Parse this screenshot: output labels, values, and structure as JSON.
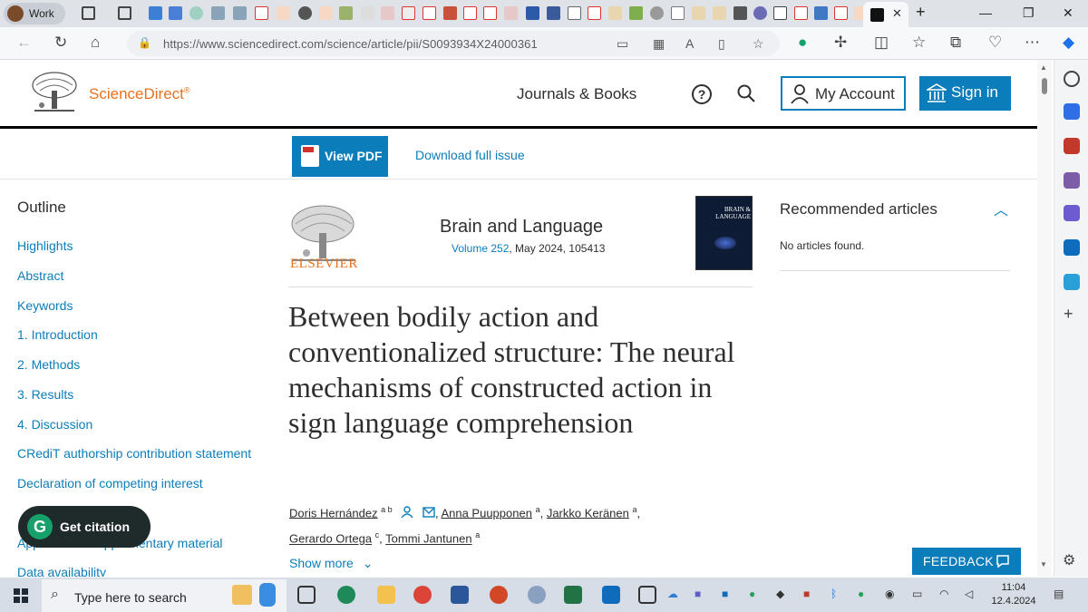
{
  "browser": {
    "profile_label": "Work",
    "url": "https://www.sciencedirect.com/science/article/pii/S0093934X24000361"
  },
  "header": {
    "brand": "ScienceDirect",
    "brand_mark": "®",
    "journals_books": "Journals & Books",
    "my_account": "My Account",
    "sign_in": "Sign in"
  },
  "pdfbar": {
    "view_pdf": "View PDF",
    "download_issue": "Download full issue"
  },
  "outline": {
    "title": "Outline",
    "items": [
      "Highlights",
      "Abstract",
      "Keywords",
      "1. Introduction",
      "2. Methods",
      "3. Results",
      "4. Discussion",
      "CRediT authorship contribution statement",
      "Declaration of competing interest",
      "Appendix A. Supplementary material",
      "Data availability"
    ]
  },
  "journal": {
    "publisher": "ELSEVIER",
    "name": "Brain and Language",
    "volume_link": "Volume 252",
    "issue_info": ", May 2024, 105413",
    "cover_title": "BRAIN & LANGUAGE"
  },
  "article": {
    "title": "Between bodily action and conventionalized structure: The neural mechanisms of constructed action in sign language comprehension",
    "authors": [
      {
        "name": "Doris Hernández",
        "aff": "a b"
      },
      {
        "name": "Anna Puupponen",
        "aff": "a"
      },
      {
        "name": "Jarkko Keränen",
        "aff": "a"
      },
      {
        "name": "Gerardo Ortega",
        "aff": "c"
      },
      {
        "name": "Tommi Jantunen",
        "aff": "a"
      }
    ],
    "show_more": "Show more"
  },
  "recommended": {
    "title": "Recommended articles",
    "empty": "No articles found."
  },
  "widgets": {
    "get_citation": "Get citation",
    "feedback": "FEEDBACK"
  },
  "taskbar": {
    "search_placeholder": "Type here to search",
    "time": "11:04",
    "date": "12.4.2024"
  },
  "colors": {
    "brand_orange": "#e9711c",
    "link_blue": "#0c7dbb",
    "text": "#2e2e2e"
  }
}
